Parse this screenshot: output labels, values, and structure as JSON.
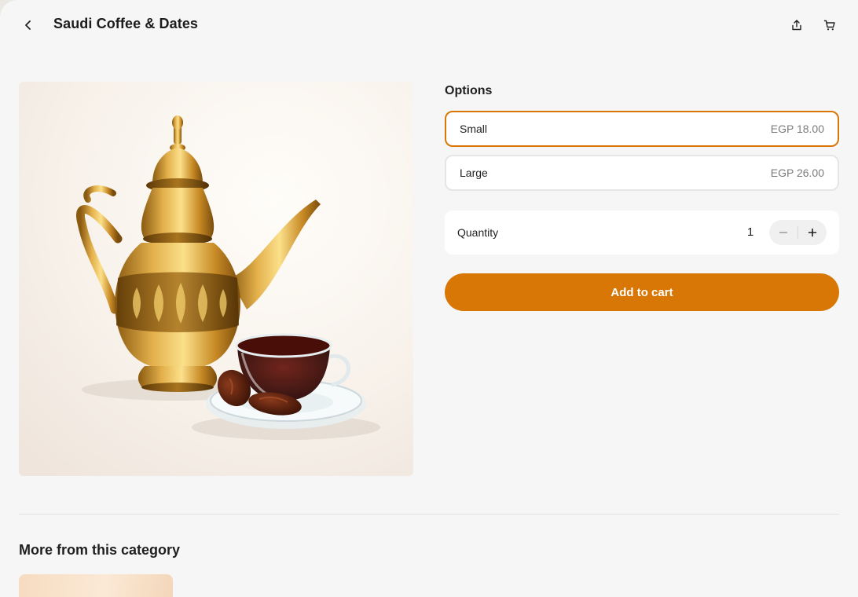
{
  "header": {
    "title": "Saudi Coffee & Dates",
    "icons": {
      "back": "chevron-left-icon",
      "share": "share-icon",
      "cart": "cart-icon"
    }
  },
  "product": {
    "image_alt": "Golden dallah coffee pot with a glass cup of coffee and dates"
  },
  "options": {
    "heading": "Options",
    "items": [
      {
        "name": "Small",
        "price": "EGP 18.00",
        "selected": true
      },
      {
        "name": "Large",
        "price": "EGP 26.00",
        "selected": false
      }
    ]
  },
  "quantity": {
    "label": "Quantity",
    "value": "1",
    "icons": {
      "minus": "minus-icon",
      "plus": "plus-icon"
    }
  },
  "actions": {
    "add_to_cart": "Add to cart"
  },
  "related": {
    "heading": "More from this category"
  },
  "colors": {
    "accent": "#d97706",
    "background": "#f6f6f6",
    "card": "#ffffff"
  }
}
